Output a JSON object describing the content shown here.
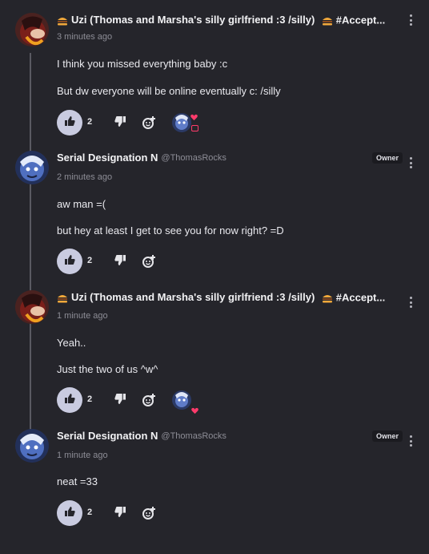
{
  "posts": [
    {
      "author": "Uzi (Thomas and Marsha's silly girlfriend :3 /silly)",
      "tag": "#Accept...",
      "time": "3 minutes ago",
      "lines": [
        "I think you missed everything baby :c",
        "But dw everyone will be online eventually c: /silly"
      ],
      "likes": "2"
    },
    {
      "author": "Serial Designation N",
      "handle": "@ThomasRocks",
      "badge": "Owner",
      "time": "2 minutes ago",
      "lines": [
        "aw man =(",
        "but hey at least I get to see you for now right? =D"
      ],
      "likes": "2"
    },
    {
      "author": "Uzi (Thomas and Marsha's silly girlfriend :3 /silly)",
      "tag": "#Accept...",
      "time": "1 minute ago",
      "lines": [
        "Yeah..",
        "Just the two of us ^w^"
      ],
      "likes": "2"
    },
    {
      "author": "Serial Designation N",
      "handle": "@ThomasRocks",
      "badge": "Owner",
      "time": "1 minute ago",
      "lines": [
        "neat =33"
      ],
      "likes": "2"
    }
  ],
  "icons": {
    "like": "thumbs-up-icon",
    "dislike": "thumbs-down-icon",
    "react": "add-reaction-icon",
    "more": "kebab-menu-icon",
    "emoji": "hamburger-emoji-icon"
  },
  "colors": {
    "background": "#25252b",
    "like_button": "#c9cbe0",
    "heart": "#ff3b6b",
    "muted_text": "#8d8d96"
  }
}
